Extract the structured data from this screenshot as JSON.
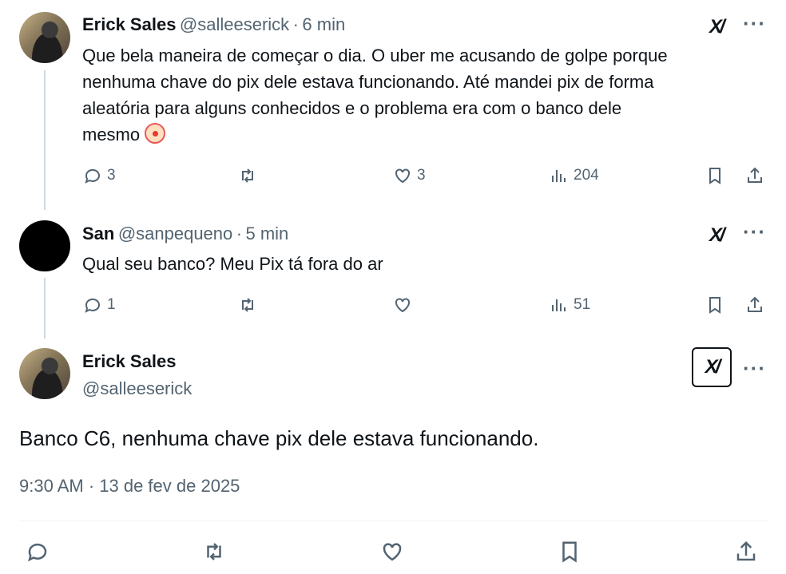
{
  "tweets": [
    {
      "name": "Erick Sales",
      "handle": "@salleeserick",
      "separator": "·",
      "time": "6 min",
      "lines": [
        "Que bela maneira de começar o dia. O uber me acusando de golpe porque",
        "nenhuma chave do pix dele estava funcionando. Até mandei pix de forma",
        "aleatória para alguns conhecidos e o problema era com o banco dele",
        "mesmo"
      ],
      "emoji": "clown-face-emoji",
      "replies": "3",
      "likes": "3",
      "views": "204"
    },
    {
      "name": "San",
      "handle": "@sanpequeno",
      "separator": "·",
      "time": "5 min",
      "lines": [
        "Qual seu banco? Meu Pix tá fora do ar"
      ],
      "replies": "1",
      "likes": "",
      "views": "51"
    }
  ],
  "main": {
    "name": "Erick Sales",
    "handle": "@salleeserick",
    "text": "Banco C6, nenhuma chave pix dele estava funcionando.",
    "timestamp": "9:30 AM · 13 de fev de 2025"
  },
  "grok_label": "X/",
  "more_label": "···",
  "icons": {
    "reply": "reply-icon",
    "retweet": "retweet-icon",
    "like": "heart-icon",
    "views": "views-icon",
    "bookmark": "bookmark-icon",
    "share": "share-icon",
    "grok": "grok-icon",
    "more": "more-icon"
  },
  "colors": {
    "text": "#0f1419",
    "secondary": "#536471",
    "line": "#cfd9de"
  }
}
